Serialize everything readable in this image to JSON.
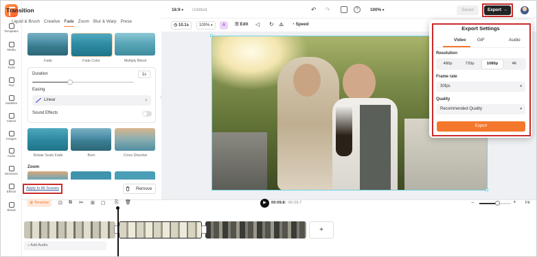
{
  "rail": {
    "items": [
      {
        "label": "Templates",
        "icon": "templates-icon"
      },
      {
        "label": "Media",
        "icon": "media-icon"
      },
      {
        "label": "Tools",
        "icon": "tools-icon"
      },
      {
        "label": "Text",
        "icon": "text-icon"
      },
      {
        "label": "Subtitles",
        "icon": "subtitles-icon"
      },
      {
        "label": "Videos",
        "icon": "videos-icon"
      },
      {
        "label": "Images",
        "icon": "images-icon"
      },
      {
        "label": "Audio",
        "icon": "audio-icon"
      },
      {
        "label": "Elements",
        "icon": "elements-icon"
      },
      {
        "label": "Effects",
        "icon": "effects-icon"
      },
      {
        "label": "Brand",
        "icon": "brand-icon"
      }
    ]
  },
  "panel": {
    "title": "Transition",
    "tabs": [
      "Liquid & Brush",
      "Creative",
      "Fade",
      "Zoom",
      "Blur & Warp",
      "Prese"
    ],
    "active_tab": "Fade",
    "row1": [
      "Fade",
      "Fade Color",
      "Multiply Blend"
    ],
    "duration_label": "Duration",
    "duration_value": "1s",
    "duration_fraction": 0.37,
    "easing_label": "Easing",
    "easing_value": "Linear",
    "sound_effects_label": "Sound Effects",
    "row2": [
      "Rotate Scale Fade",
      "Burn",
      "Cross Dissolve"
    ],
    "zoom_heading": "Zoom",
    "apply_all": "Apply to All Scenes",
    "remove": "Remove"
  },
  "topbar": {
    "aspect": "16:9",
    "project_name": "Untitled",
    "zoom": "100%",
    "saved": "Saved",
    "export": "Export"
  },
  "tools": {
    "duration": "10.1s",
    "scale": "100%",
    "edit": "Edit",
    "speed": "Speed"
  },
  "export_settings": {
    "title": "Export Settings",
    "tabs": [
      "Video",
      "GIF",
      "Audio"
    ],
    "active_tab": "Video",
    "resolution_label": "Resolution",
    "resolutions": [
      "480p",
      "720p",
      "1080p",
      "4K"
    ],
    "selected_resolution": "1080p",
    "frame_rate_label": "Frame rate",
    "frame_rate": "30fps",
    "quality_label": "Quality",
    "quality": "Recommended Quality",
    "export_button": "Export"
  },
  "timeline": {
    "label": "Timeline",
    "current_time": "00:09.8",
    "total_time": "00:29.7",
    "fit": "Fit",
    "add_audio": "Add Audio",
    "zoom_fraction": 0.58
  },
  "colors": {
    "accent": "#f4782c",
    "highlight": "#c92a2a",
    "selection": "#6fd3e6"
  }
}
